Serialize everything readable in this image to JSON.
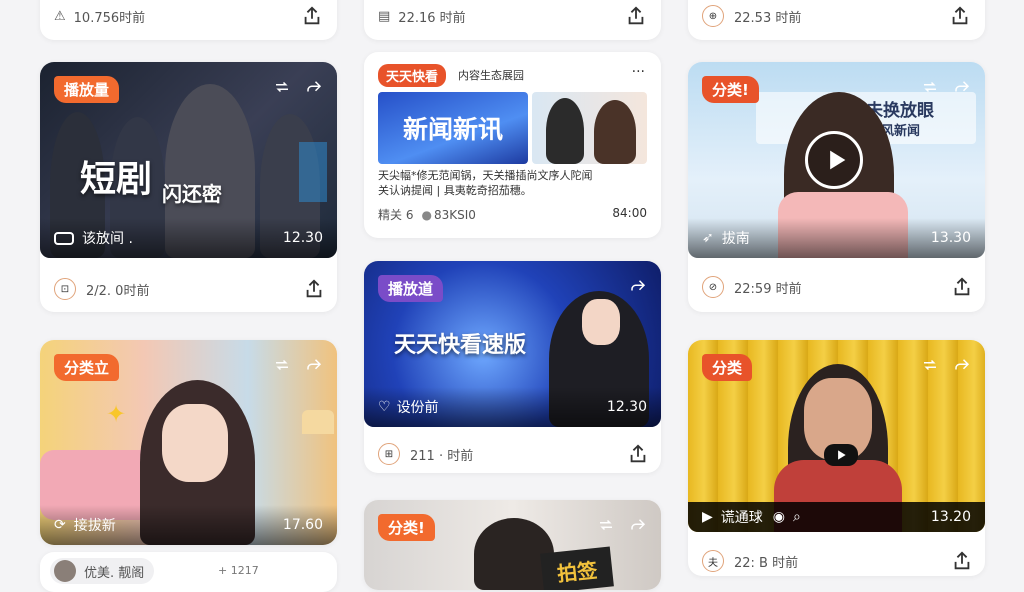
{
  "colors": {
    "tag_orange": "#f26a2e",
    "tag_purple": "#7a4cc8",
    "accent_red": "#e8532a",
    "text_gray": "#555555"
  },
  "top_row": [
    {
      "meta": "10.756时前",
      "avatar": "⚠"
    },
    {
      "meta": "22.16 时前",
      "avatar": "▤"
    },
    {
      "meta": "22.53 时前",
      "avatar": "⊕"
    }
  ],
  "col1": {
    "card1": {
      "tag": "播放量",
      "headline": "短剧",
      "subline": "闪还密",
      "bottom_left": "该放间 .",
      "duration": "12.30",
      "meta": "2/2. 0时前",
      "avatar": "⊡"
    },
    "card2": {
      "tag": "分类立",
      "bottom_left": "接拔新",
      "duration": "17.60"
    },
    "card3": {
      "name": "优美. 靓阁",
      "extra": "+ 1217"
    }
  },
  "col2": {
    "news": {
      "brand": "天天快看",
      "subtitle": "内容生态展园",
      "more": "···",
      "banner_text": "新闻新讯",
      "desc_line1": "天尖幅*修无范闻锅，天关播插尚文序人陀闻",
      "desc_line2": "关认讷提闻 | 具夷乾奇招茄穗。",
      "stats_left": "精关 6",
      "stats_mid": "83KSI0",
      "stats_right": "84:00"
    },
    "card2": {
      "tag": "播放道",
      "headline": "天天快看速版",
      "bottom_left": "设份前",
      "duration": "12.30",
      "meta": "211 · 时前",
      "avatar": "⊞"
    },
    "card3": {
      "tag": "分类!",
      "sign": "拍签"
    }
  },
  "col3": {
    "card1": {
      "tag": "分类!",
      "sign_text_1": "未换放眼",
      "sign_text_2": "的风新闻",
      "bottom_left": "拔南",
      "duration": "13.30",
      "meta": "22:59 时前",
      "avatar": "⊘"
    },
    "card2": {
      "tag": "分类",
      "bottom_left": "谎通球",
      "duration": "13.20",
      "meta": "22: B 时前",
      "avatar": "夫"
    }
  }
}
